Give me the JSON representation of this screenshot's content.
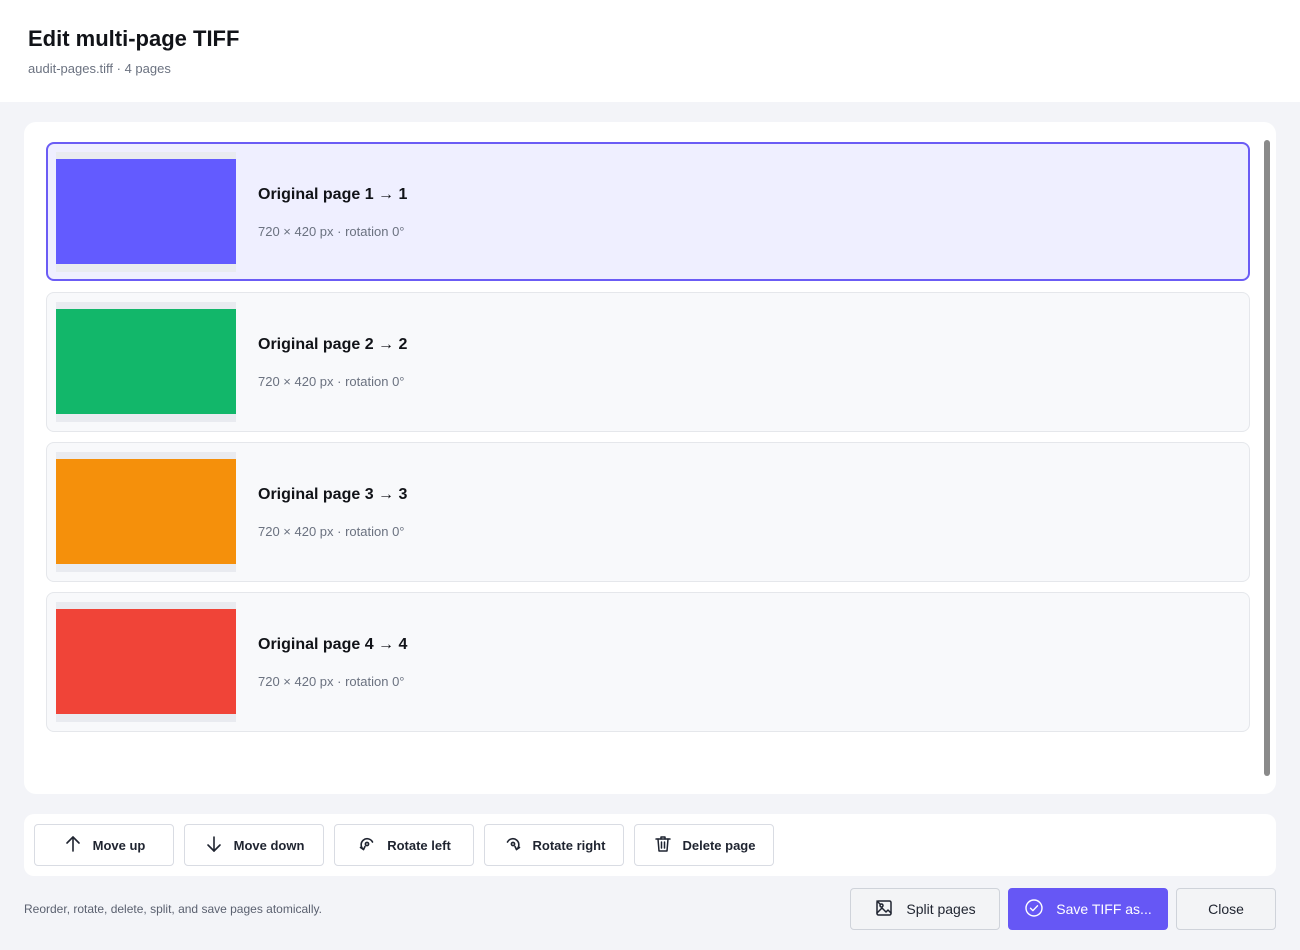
{
  "dialog": {
    "title": "Edit multi-page TIFF",
    "subtitle": "audit-pages.tiff · 4 pages"
  },
  "pages": [
    {
      "title": "Original page 1  →  1",
      "meta": "720 × 420 px · rotation 0°",
      "color": "#635bff",
      "selected": true
    },
    {
      "title": "Original page 2  →  2",
      "meta": "720 × 420 px · rotation 0°",
      "color": "#12b76a",
      "selected": false
    },
    {
      "title": "Original page 3  →  3",
      "meta": "720 × 420 px · rotation 0°",
      "color": "#f5900b",
      "selected": false
    },
    {
      "title": "Original page 4  →  4",
      "meta": "720 × 420 px · rotation 0°",
      "color": "#f04438",
      "selected": false
    }
  ],
  "toolbar": {
    "move_up": {
      "label": "Move up",
      "icon": "arrow-up-icon"
    },
    "move_down": {
      "label": "Move down",
      "icon": "arrow-down-icon"
    },
    "rotate_left": {
      "label": "Rotate left",
      "icon": "rotate-left-icon"
    },
    "rotate_right": {
      "label": "Rotate right",
      "icon": "rotate-right-icon"
    },
    "delete_page": {
      "label": "Delete page",
      "icon": "trash-icon"
    }
  },
  "footer": {
    "hint": "Reorder, rotate, delete, split, and save pages atomically.",
    "split_label": "Split pages",
    "save_label": "Save TIFF as...",
    "close_label": "Close"
  },
  "colors": {
    "accent": "#6657f5",
    "selected_border": "#6b5cf5",
    "selected_bg": "#efefff"
  }
}
